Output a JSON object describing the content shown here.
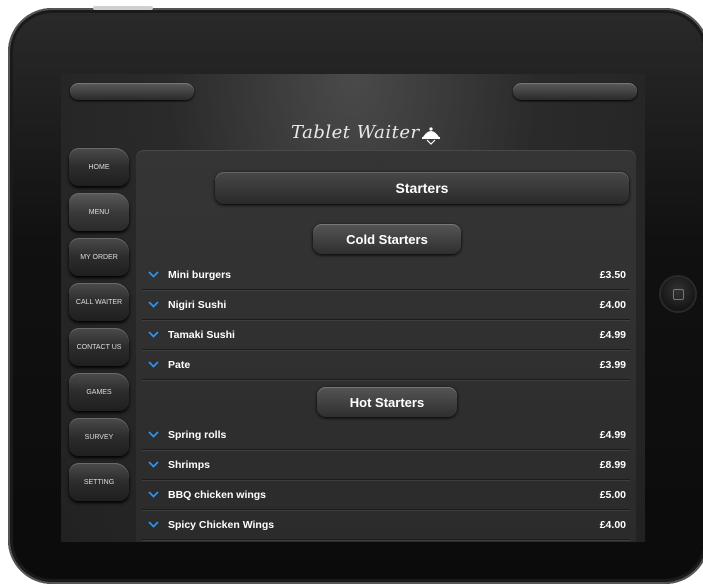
{
  "app": {
    "logo_text": "Tablet Waiter"
  },
  "sidebar": {
    "items": [
      {
        "label": "HOME"
      },
      {
        "label": "MENU"
      },
      {
        "label": "MY ORDER"
      },
      {
        "label": "CALL WAITER"
      },
      {
        "label": "CONTACT US"
      },
      {
        "label": "GAMES"
      },
      {
        "label": "SURVEY"
      },
      {
        "label": "SETTING"
      }
    ]
  },
  "main": {
    "title": "Starters",
    "categories": [
      {
        "label": "Cold Starters",
        "items": [
          {
            "name": "Mini burgers",
            "price": "£3.50"
          },
          {
            "name": "Nigiri Sushi",
            "price": "£4.00"
          },
          {
            "name": "Tamaki Sushi",
            "price": "£4.99"
          },
          {
            "name": "Pate",
            "price": "£3.99"
          }
        ]
      },
      {
        "label": "Hot Starters",
        "items": [
          {
            "name": "Spring rolls",
            "price": "£4.99"
          },
          {
            "name": "Shrimps",
            "price": "£8.99"
          },
          {
            "name": "BBQ chicken wings",
            "price": "£5.00"
          },
          {
            "name": "Spicy Chicken Wings",
            "price": "£4.00"
          }
        ]
      }
    ]
  },
  "colors": {
    "accent": "#3a8fe0",
    "background": "#2b2b2b",
    "text": "#ffffff"
  },
  "icons": {
    "expand": "chevron-down-icon",
    "logo": "cloche-icon"
  }
}
